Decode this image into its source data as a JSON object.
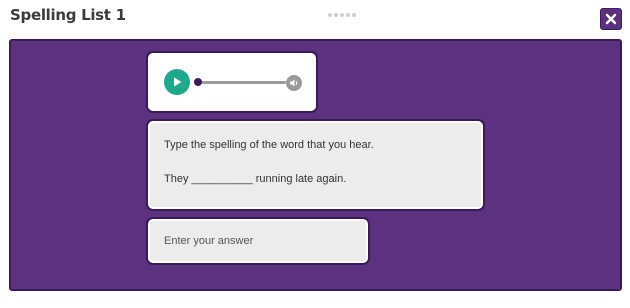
{
  "header": {
    "title": "Spelling List 1",
    "close_icon": "close-icon"
  },
  "audio_player": {
    "play_icon": "play-icon",
    "volume_icon": "volume-icon",
    "progress": 0
  },
  "question": {
    "instruction": "Type the spelling of the word that you hear.",
    "sentence": "They __________ running late again."
  },
  "answer": {
    "placeholder": "Enter your answer",
    "value": ""
  },
  "colors": {
    "panel": "#5c3280",
    "play_button": "#1fa98c",
    "card": "#ececec"
  }
}
